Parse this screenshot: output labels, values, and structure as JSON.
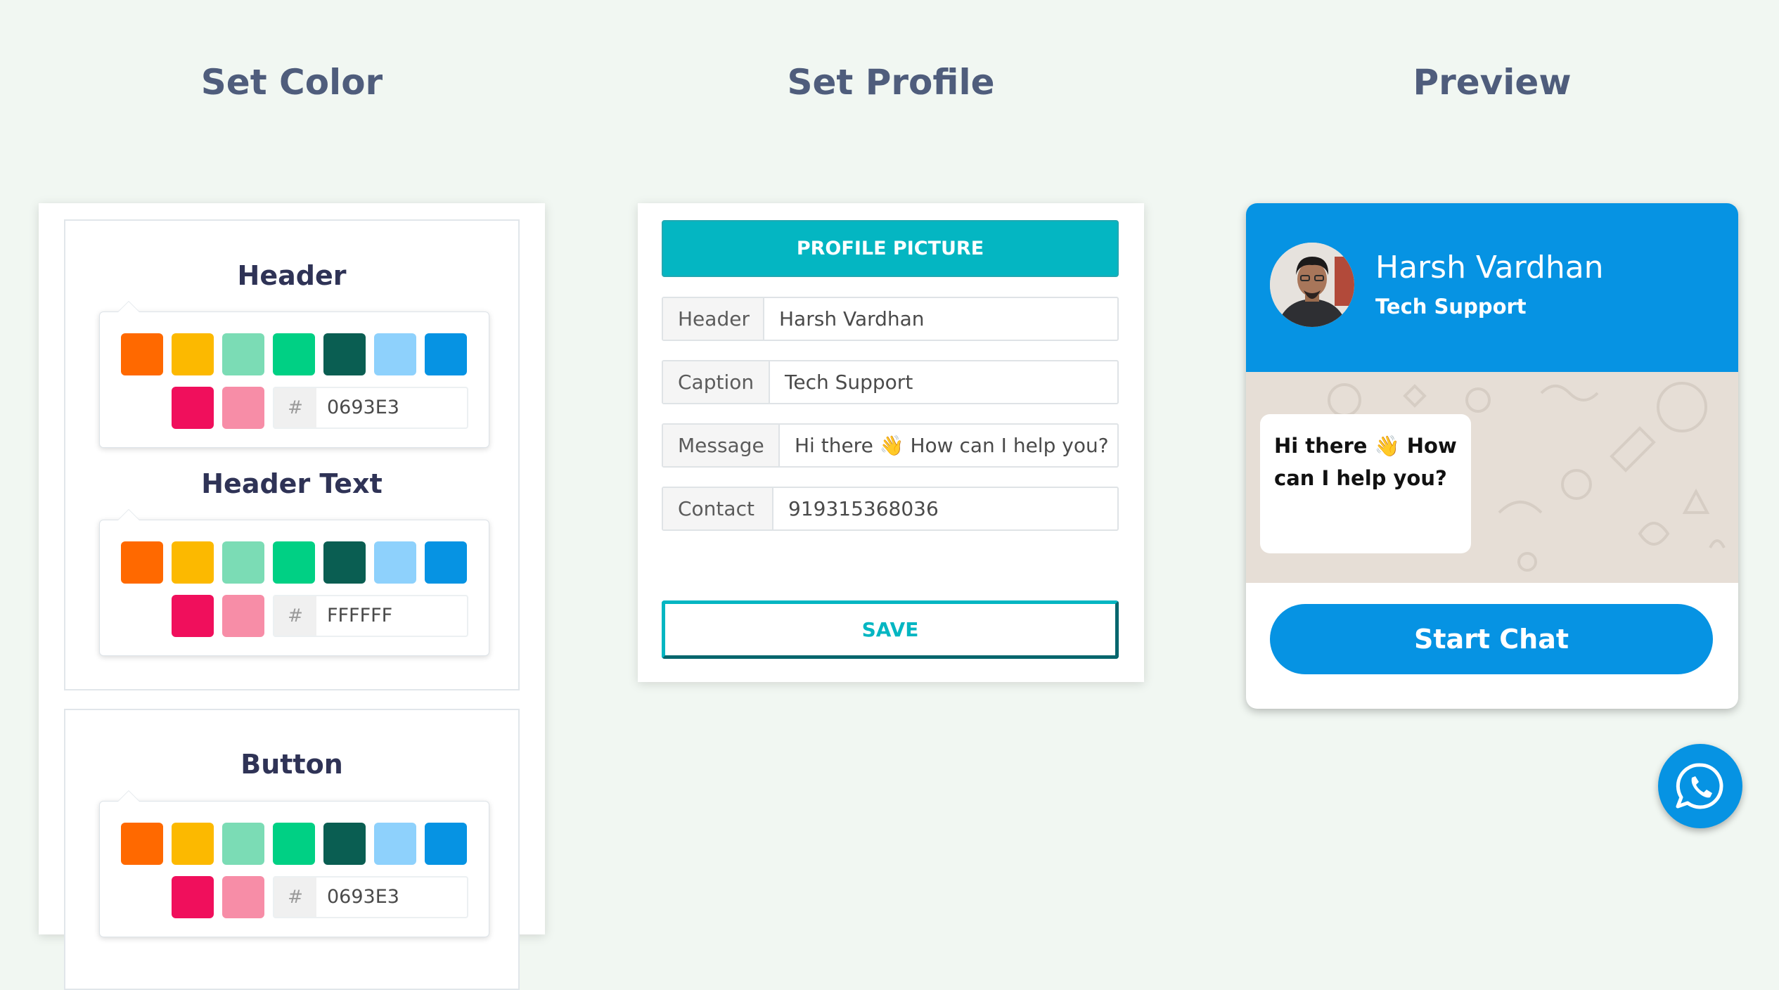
{
  "columns": {
    "set_color": "Set Color",
    "set_profile": "Set Profile",
    "preview": "Preview"
  },
  "color_sections": [
    {
      "title": "Header",
      "hex_prefix": "#",
      "hex_value": "0693E3"
    },
    {
      "title": "Header Text",
      "hex_prefix": "#",
      "hex_value": "FFFFFF"
    },
    {
      "title": "Button",
      "hex_prefix": "#",
      "hex_value": "0693E3"
    }
  ],
  "palette": [
    "#ff6900",
    "#fcb900",
    "#7bdcb5",
    "#00d084",
    "#0a5e52",
    "#8ed1fc",
    "#0693e3",
    "#f00f5c",
    "#f78da7"
  ],
  "profile_form": {
    "picture_button": "PROFILE PICTURE",
    "fields": [
      {
        "label": "Header",
        "value": "Harsh Vardhan"
      },
      {
        "label": "Caption",
        "value": "Tech Support"
      },
      {
        "label": "Message",
        "value": "Hi there 👋 How can I help you?"
      },
      {
        "label": "Contact",
        "value": "919315368036"
      }
    ],
    "save_button": "SAVE"
  },
  "preview": {
    "name": "Harsh Vardhan",
    "caption": "Tech Support",
    "message": "Hi there 👋 How can I help you?",
    "start_button": "Start Chat",
    "header_color": "#0693e3",
    "chat_bg_color": "#e6ded6"
  },
  "icons": {
    "avatar": "profile-photo",
    "fab": "whatsapp-icon"
  }
}
